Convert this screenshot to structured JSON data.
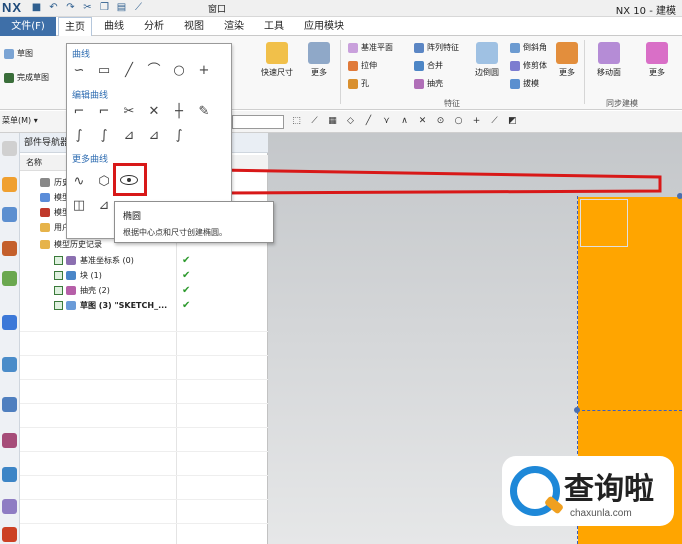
{
  "titlebar": {
    "logo": "NX",
    "window_menu": "窗口",
    "app_title": "NX 10 - 建模"
  },
  "tabs": {
    "file": "文件(F)",
    "items": [
      "主页",
      "曲线",
      "分析",
      "视图",
      "渲染",
      "工具",
      "应用模块"
    ]
  },
  "ribbon": {
    "sketch": "草图",
    "finish_sketch": "完成草图",
    "quick_dim": "快速尺寸",
    "more1": "更多",
    "datum_plane": "基准平面",
    "pattern_feature": "阵列特征",
    "chamfer": "倒斜角",
    "extrude": "拉伸",
    "unite": "合并",
    "trim_body": "修剪体",
    "hole": "孔",
    "shell": "抽壳",
    "draft": "拔模",
    "edge_blend": "边倒圆",
    "more2": "更多",
    "feature_group": "特征",
    "move_face": "移动面",
    "more3": "更多",
    "sync_group": "同步建模"
  },
  "toolbar2": {
    "menu": "菜单(M)"
  },
  "dropdown": {
    "section_curve": "曲线",
    "section_edit": "编辑曲线",
    "section_more": "更多曲线",
    "curve_icons": [
      "∽",
      "▭",
      "╱",
      "⌒",
      "○",
      "+"
    ],
    "edit_icons": [
      "⌐",
      "⌐",
      "✂",
      "✕",
      "┼",
      "✎"
    ],
    "edit_icons2": [
      "∫",
      "∫",
      "⊿",
      "⊿",
      "∫"
    ],
    "more_icons": [
      "∿",
      "⬡"
    ],
    "more_icons2": [
      "◫",
      "⊿"
    ]
  },
  "tooltip": {
    "title": "椭圆",
    "description": "根据中心点和尺寸创建椭圆。"
  },
  "navigator": {
    "title": "部件导航器",
    "col_name": "名称",
    "rows": [
      {
        "label": "历史",
        "tick": false
      },
      {
        "label": "模型",
        "tick": false
      },
      {
        "label": "模型",
        "tick": false
      },
      {
        "label": "用户",
        "tick": false
      },
      {
        "label": "模型历史记录",
        "tick": false
      },
      {
        "label": "基准坐标系 (0)",
        "tick": true
      },
      {
        "label": "块 (1)",
        "tick": true
      },
      {
        "label": "抽壳 (2)",
        "tick": true
      },
      {
        "label": "草图 (3) \"SKETCH_...",
        "tick": true
      }
    ]
  },
  "watermark": {
    "brand": "查询啦",
    "url": "chaxunla.com"
  },
  "colors": {
    "accent": "#3e6fa8",
    "highlight": "#d81818",
    "solid": "#ffa500",
    "watermark_blue": "#1e88d8"
  }
}
